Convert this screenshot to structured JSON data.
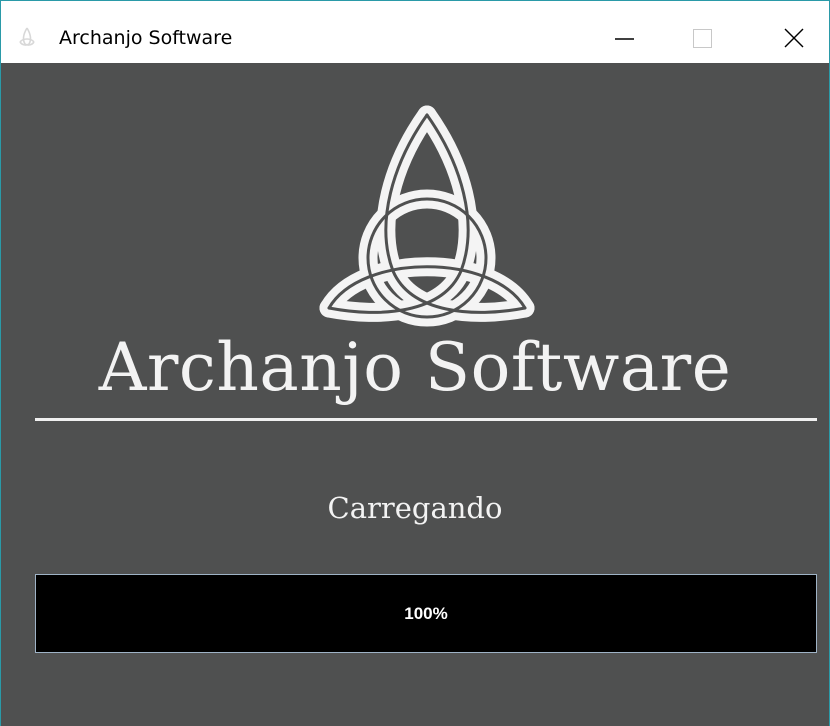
{
  "window": {
    "title": "Archanjo Software",
    "icon": "triquetra-icon",
    "controls": {
      "minimize": "minimize-icon",
      "maximize": "maximize-icon",
      "close": "close-icon"
    }
  },
  "splash": {
    "logo": "triquetra-logo",
    "brand_name": "Archanjo Software",
    "status": "Carregando"
  },
  "progress": {
    "label": "100%",
    "value_percent": 100
  },
  "colors": {
    "background": "#4f5050",
    "foreground": "#f3f3f3",
    "progress_track": "#000000",
    "progress_border": "#9fb3c6",
    "titlebar": "#ffffff",
    "window_border": "#2a9aa8"
  }
}
